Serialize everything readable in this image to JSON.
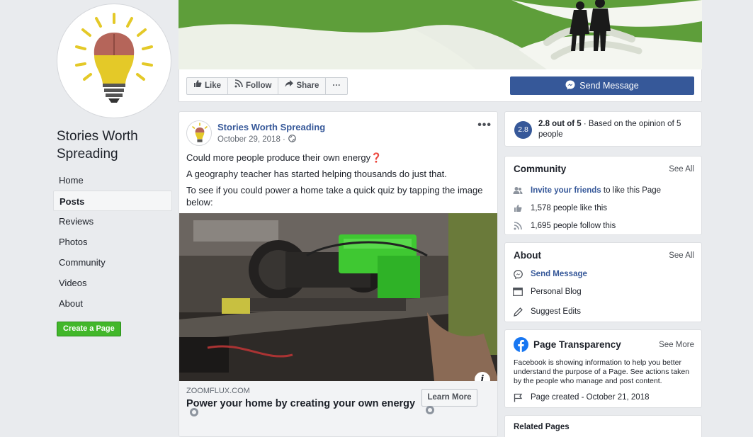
{
  "page": {
    "name_line1": "Stories Worth",
    "name_line2": "Spreading"
  },
  "nav": {
    "items": [
      {
        "label": "Home"
      },
      {
        "label": "Posts"
      },
      {
        "label": "Reviews"
      },
      {
        "label": "Photos"
      },
      {
        "label": "Community"
      },
      {
        "label": "Videos"
      },
      {
        "label": "About"
      }
    ],
    "active": "Posts",
    "create_page": "Create a Page"
  },
  "actions": {
    "like": "Like",
    "follow": "Follow",
    "share": "Share",
    "more": "···",
    "send_message": "Send Message"
  },
  "post": {
    "author": "Stories Worth Spreading",
    "date": "October 29, 2018 ·",
    "more": "•••",
    "line1": "Could more people produce their own energy",
    "line1_emoji": "❓",
    "line2": "A geography teacher has started helping thousands do just that.",
    "line3": "To see if you could power a home take a quick quiz by tapping the image below:",
    "info": "i",
    "link_domain": "ZOOMFLUX.COM",
    "link_title": "Power your home by creating your own energy",
    "learn_more": "Learn More"
  },
  "rating": {
    "badge": "2.8",
    "score": "2.8 out of 5",
    "rest": " · Based on the opinion of 5 people"
  },
  "community": {
    "title": "Community",
    "see_all": "See All",
    "invite_link": "Invite your friends",
    "invite_rest": "to like this Page",
    "likes": "1,578 people like this",
    "follows": "1,695 people follow this"
  },
  "about": {
    "title": "About",
    "see_all": "See All",
    "send_message": "Send Message",
    "personal_blog": "Personal Blog",
    "suggest_edits": "Suggest Edits"
  },
  "transparency": {
    "title": "Page Transparency",
    "see_more": "See More",
    "description": "Facebook is showing information to help you better understand the purpose of a Page. See actions taken by the people who manage and post content.",
    "created": "Page created - October 21, 2018"
  },
  "related": {
    "title": "Related Pages"
  },
  "colors": {
    "brand_blue": "#365899",
    "link_blue": "#365899",
    "create_green": "#42b72a",
    "cover_green": "#5e9e3a",
    "page_bg": "#e9ebee"
  },
  "icons": [
    "lightbulb-brain-logo",
    "thumbs-up-icon",
    "rss-follow-icon",
    "share-arrow-icon",
    "messenger-icon",
    "globe-icon",
    "info-icon",
    "friends-icon",
    "rss-icon",
    "flag-icon",
    "pencil-icon",
    "facebook-logo-icon",
    "blog-icon"
  ]
}
